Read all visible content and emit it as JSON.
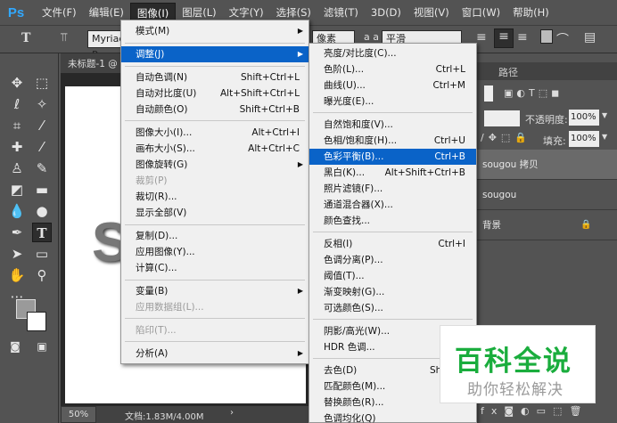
{
  "app": {
    "logo": "Ps"
  },
  "menubar": [
    "文件(F)",
    "编辑(E)",
    "图像(I)",
    "图层(L)",
    "文字(Y)",
    "选择(S)",
    "滤镜(T)",
    "3D(D)",
    "视图(V)",
    "窗口(W)",
    "帮助(H)"
  ],
  "options": {
    "tool_glyph": "T",
    "font_field": "Myriad P",
    "unit_field": "像素",
    "aa_label": "a a",
    "aa_field": "平滑"
  },
  "document": {
    "tab_title": "未标题-1 @",
    "canvas_glyph": "S",
    "zoom": "50%",
    "doc_info": "文档:1.83M/4.00M"
  },
  "panels": {
    "tab_paths": "路径",
    "opacity_label": "不透明度:",
    "opacity_value": "100%",
    "fill_label": "填充:",
    "fill_value": "100%",
    "layers": [
      "sougou 拷贝",
      "sougou",
      "背景"
    ]
  },
  "image_menu": {
    "items": [
      {
        "label": "模式(M)",
        "shortcut": "",
        "submenu": true,
        "disabled": false
      },
      {
        "label": "调整(J)",
        "shortcut": "",
        "submenu": true,
        "disabled": false,
        "highlight": true
      },
      {
        "label": "自动色调(N)",
        "shortcut": "Shift+Ctrl+L"
      },
      {
        "label": "自动对比度(U)",
        "shortcut": "Alt+Shift+Ctrl+L"
      },
      {
        "label": "自动颜色(O)",
        "shortcut": "Shift+Ctrl+B"
      },
      {
        "label": "图像大小(I)...",
        "shortcut": "Alt+Ctrl+I"
      },
      {
        "label": "画布大小(S)...",
        "shortcut": "Alt+Ctrl+C"
      },
      {
        "label": "图像旋转(G)",
        "shortcut": "",
        "submenu": true
      },
      {
        "label": "裁剪(P)",
        "shortcut": "",
        "disabled": true
      },
      {
        "label": "裁切(R)...",
        "shortcut": ""
      },
      {
        "label": "显示全部(V)",
        "shortcut": ""
      },
      {
        "label": "复制(D)...",
        "shortcut": ""
      },
      {
        "label": "应用图像(Y)...",
        "shortcut": ""
      },
      {
        "label": "计算(C)...",
        "shortcut": ""
      },
      {
        "label": "变量(B)",
        "shortcut": "",
        "submenu": true
      },
      {
        "label": "应用数据组(L)...",
        "shortcut": "",
        "disabled": true
      },
      {
        "label": "陷印(T)...",
        "shortcut": "",
        "disabled": true
      },
      {
        "label": "分析(A)",
        "shortcut": "",
        "submenu": true
      }
    ]
  },
  "adjust_menu": {
    "items": [
      {
        "label": "亮度/对比度(C)...",
        "shortcut": ""
      },
      {
        "label": "色阶(L)...",
        "shortcut": "Ctrl+L"
      },
      {
        "label": "曲线(U)...",
        "shortcut": "Ctrl+M"
      },
      {
        "label": "曝光度(E)...",
        "shortcut": ""
      },
      {
        "label": "自然饱和度(V)...",
        "shortcut": ""
      },
      {
        "label": "色相/饱和度(H)...",
        "shortcut": "Ctrl+U"
      },
      {
        "label": "色彩平衡(B)...",
        "shortcut": "Ctrl+B",
        "highlight": true
      },
      {
        "label": "黑白(K)...",
        "shortcut": "Alt+Shift+Ctrl+B"
      },
      {
        "label": "照片滤镜(F)...",
        "shortcut": ""
      },
      {
        "label": "通道混合器(X)...",
        "shortcut": ""
      },
      {
        "label": "颜色查找...",
        "shortcut": ""
      },
      {
        "label": "反相(I)",
        "shortcut": "Ctrl+I"
      },
      {
        "label": "色调分离(P)...",
        "shortcut": ""
      },
      {
        "label": "阈值(T)...",
        "shortcut": ""
      },
      {
        "label": "渐变映射(G)...",
        "shortcut": ""
      },
      {
        "label": "可选颜色(S)...",
        "shortcut": ""
      },
      {
        "label": "阴影/高光(W)...",
        "shortcut": ""
      },
      {
        "label": "HDR 色调...",
        "shortcut": ""
      },
      {
        "label": "去色(D)",
        "shortcut": "Shift+C"
      },
      {
        "label": "匹配颜色(M)...",
        "shortcut": ""
      },
      {
        "label": "替换颜色(R)...",
        "shortcut": ""
      },
      {
        "label": "色调均化(Q)",
        "shortcut": ""
      }
    ]
  },
  "watermark": {
    "title": "百科全说",
    "subtitle": "助你轻松解决"
  },
  "colors": {
    "highlight": "#0a63c8",
    "ps_blue": "#31a8ff",
    "watermark_green": "#1aad3d"
  }
}
